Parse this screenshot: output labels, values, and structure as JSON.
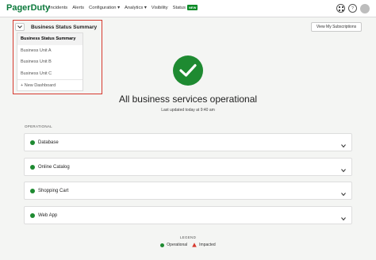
{
  "nav": {
    "logo": "PagerDuty",
    "links": [
      "Incidents",
      "Alerts",
      "Configuration ▾",
      "Analytics ▾",
      "Visibility",
      "Status"
    ],
    "status_badge": "NEW",
    "icons": [
      "grid-icon",
      "help-icon",
      "avatar"
    ]
  },
  "subscriptions_button": "View My Subscriptions",
  "dropdown": {
    "title": "Business Status Summary",
    "items": [
      "Business Status Summary",
      "Business Unit A",
      "Business Unit B",
      "Business Unit C"
    ],
    "new_item": "+ New Dashboard"
  },
  "status": {
    "title": "All business services operational",
    "updated": "Last updated today at 9:40 am",
    "color": "#1e8a31"
  },
  "section_label": "OPERATIONAL",
  "services": [
    "Database",
    "Online Catalog",
    "Shopping Cart",
    "Web App"
  ],
  "legend": {
    "label": "LEGEND",
    "operational": "Operational",
    "impacted": "Impacted",
    "impacted_color": "#d63a2f"
  }
}
